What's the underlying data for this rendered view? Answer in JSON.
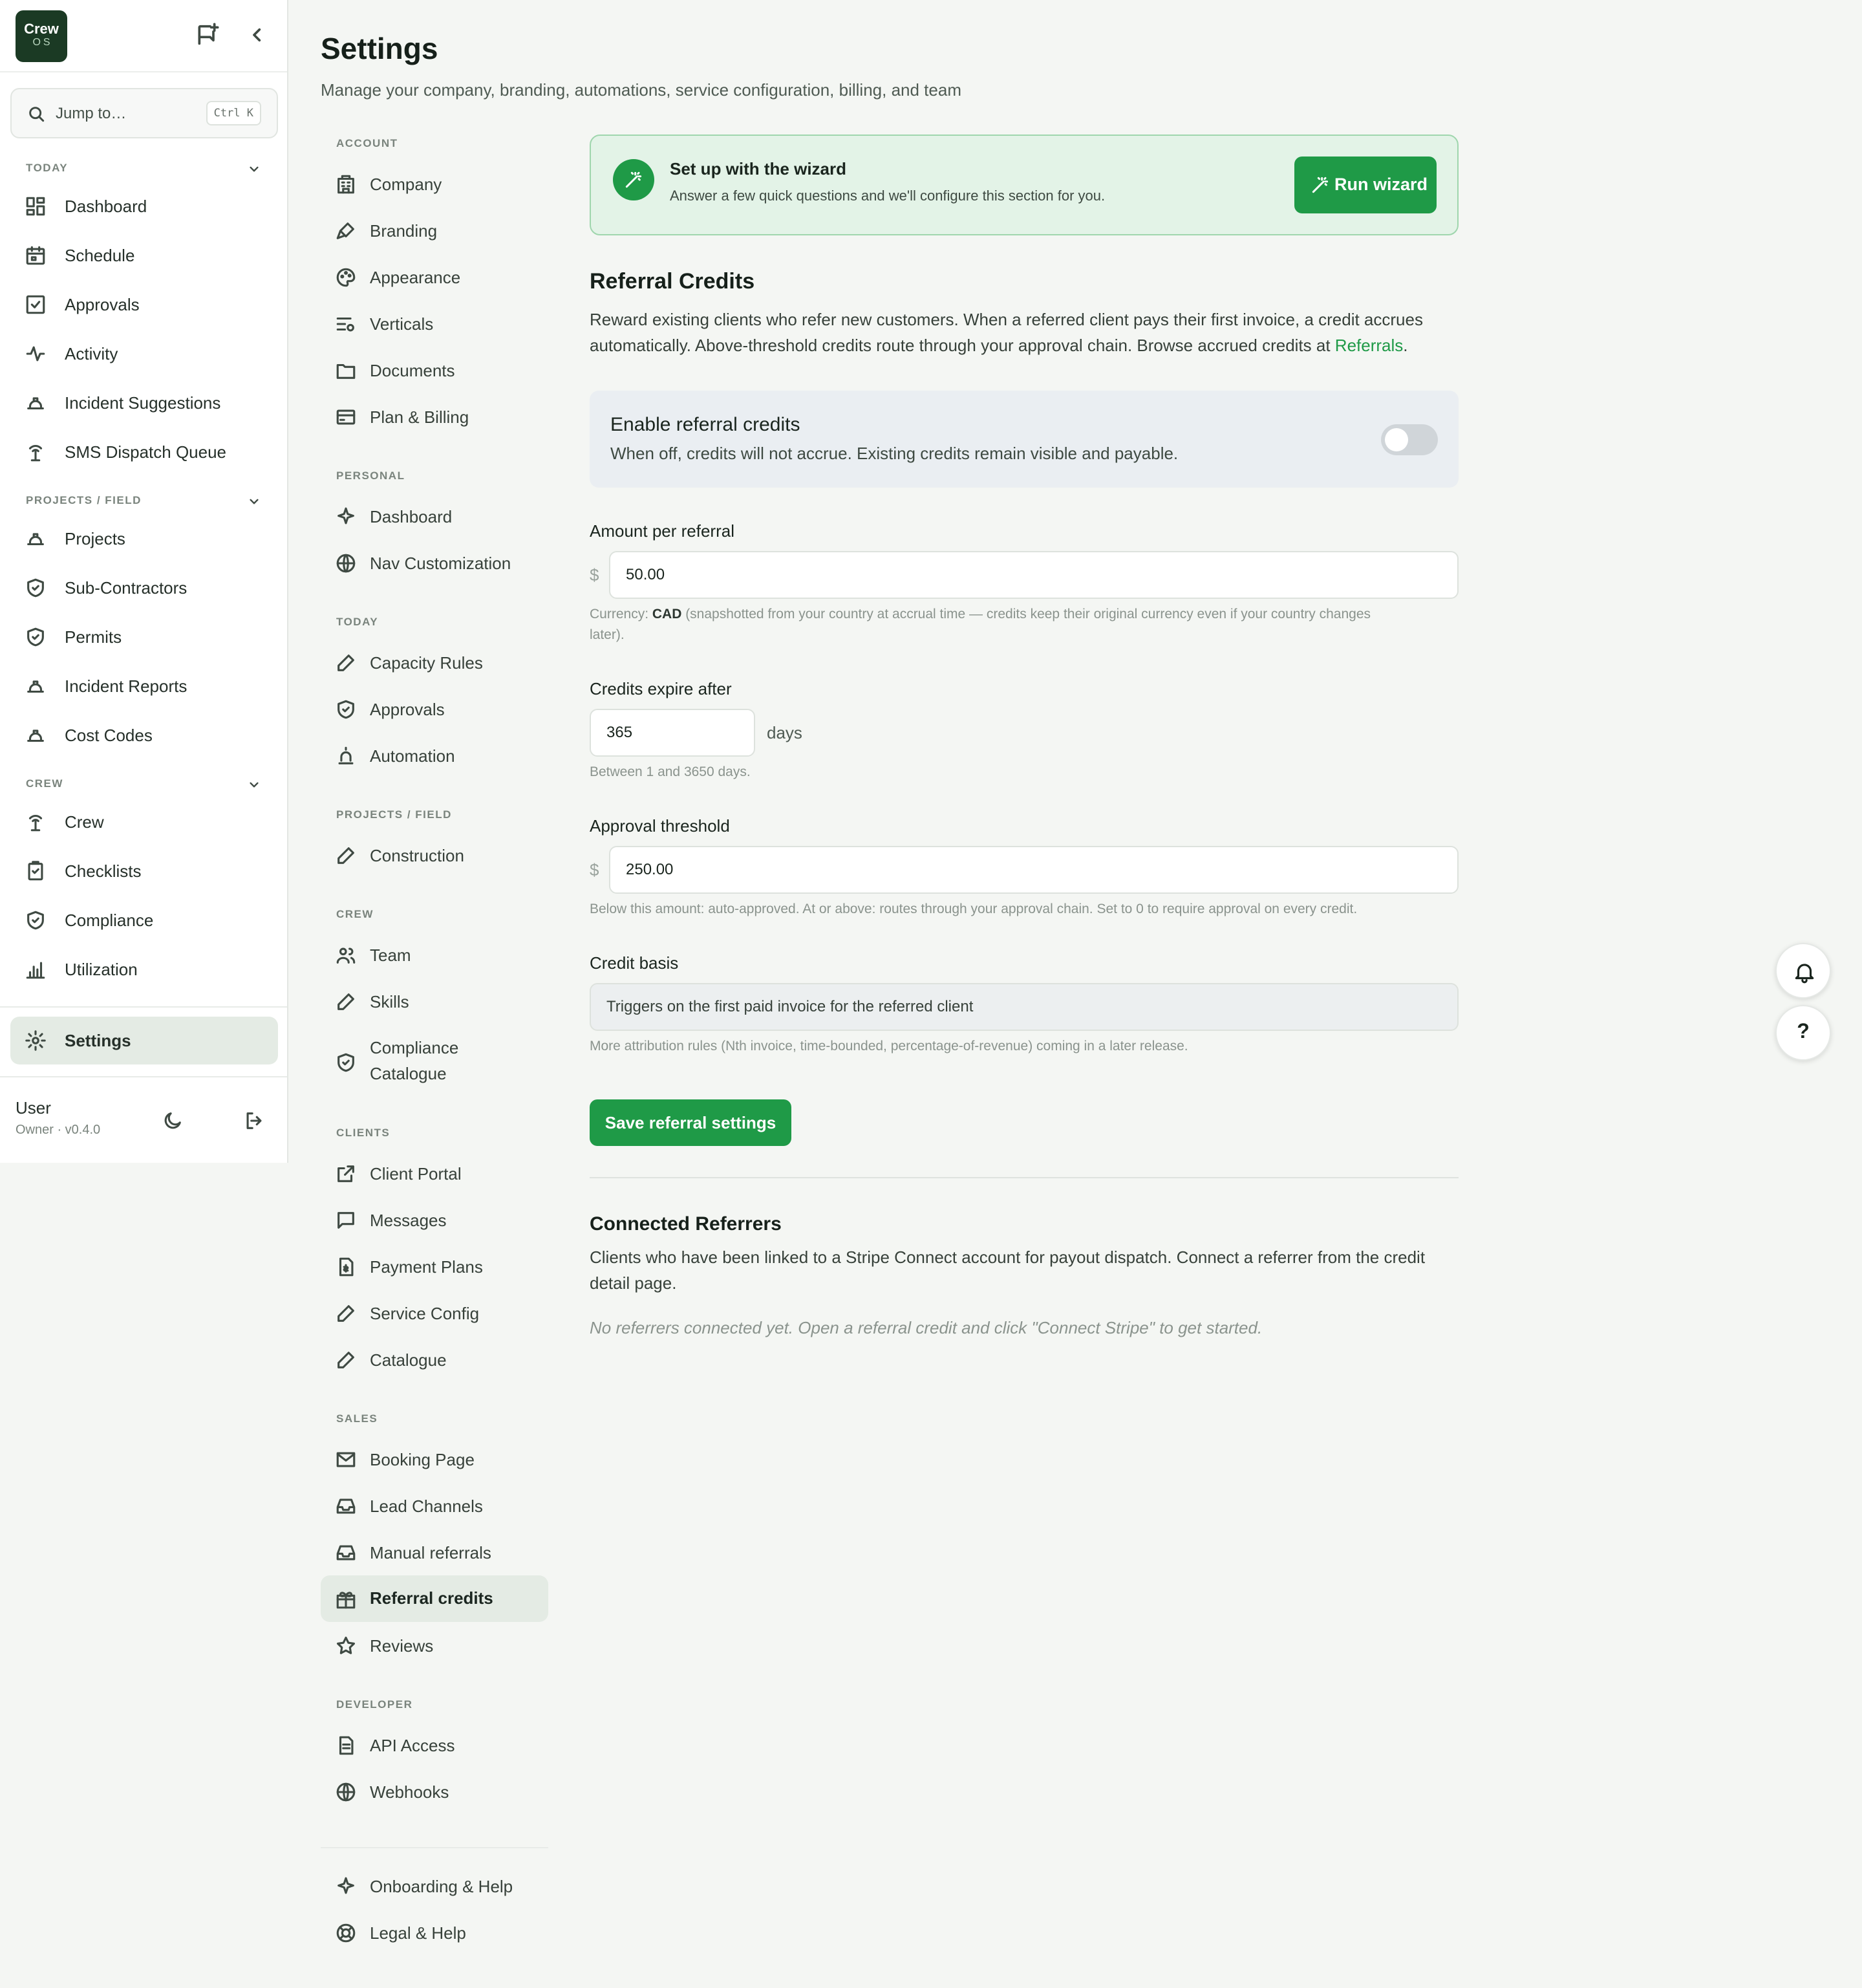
{
  "app": {
    "logo_line1": "Crew",
    "logo_line2": "OS"
  },
  "search": {
    "placeholder": "Jump to…",
    "shortcut": "Ctrl K"
  },
  "sidebar": {
    "sections": [
      {
        "label": "TODAY",
        "items": [
          "Dashboard",
          "Schedule",
          "Approvals",
          "Activity",
          "Incident Suggestions",
          "SMS Dispatch Queue"
        ]
      },
      {
        "label": "PROJECTS / FIELD",
        "items": [
          "Projects",
          "Sub-Contractors",
          "Permits",
          "Incident Reports",
          "Cost Codes"
        ]
      },
      {
        "label": "CREW",
        "items": [
          "Crew",
          "Checklists",
          "Compliance",
          "Utilization"
        ]
      }
    ],
    "settings_label": "Settings",
    "user_name": "User",
    "user_role": "Owner · v0.4.0"
  },
  "page": {
    "title": "Settings",
    "subtitle": "Manage your company, branding, automations, service configuration, billing, and team"
  },
  "settings_nav": {
    "account_label": "ACCOUNT",
    "account": [
      "Company",
      "Branding",
      "Appearance",
      "Verticals",
      "Documents",
      "Plan & Billing"
    ],
    "personal_label": "PERSONAL",
    "personal": [
      "Dashboard",
      "Nav Customization"
    ],
    "today_label": "TODAY",
    "today": [
      "Capacity Rules",
      "Approvals",
      "Automation"
    ],
    "projects_label": "PROJECTS / FIELD",
    "projects": [
      "Construction"
    ],
    "crew_label": "CREW",
    "crew": [
      "Team",
      "Skills",
      "Compliance Catalogue"
    ],
    "clients_label": "CLIENTS",
    "clients": [
      "Client Portal",
      "Messages",
      "Payment Plans",
      "Service Config",
      "Catalogue"
    ],
    "sales_label": "SALES",
    "sales": [
      "Booking Page",
      "Lead Channels",
      "Manual referrals",
      "Referral credits",
      "Reviews"
    ],
    "developer_label": "DEVELOPER",
    "developer": [
      "API Access",
      "Webhooks"
    ],
    "footer": [
      "Onboarding & Help",
      "Legal & Help"
    ]
  },
  "wizard": {
    "title": "Set up with the wizard",
    "subtitle": "Answer a few quick questions and we'll configure this section for you.",
    "button": "Run wizard"
  },
  "referral": {
    "heading": "Referral Credits",
    "description_1": "Reward existing clients who refer new customers. When a referred client pays their first invoice, a credit accrues",
    "description_2": "automatically. Above-threshold credits route through your approval chain. Browse accrued credits at ",
    "description_link": "Referrals",
    "description_end": ".",
    "toggle_title": "Enable referral credits",
    "toggle_desc": "When off, credits will not accrue. Existing credits remain visible and payable.",
    "toggle_on": false,
    "amount_label": "Amount per referral",
    "currency_symbol": "$",
    "amount_value": "50.00",
    "currency_prefix": "Currency: ",
    "currency_code": "CAD",
    "currency_note_1": " (snapshotted from your country at accrual time — credits keep their original currency even if your country changes",
    "currency_note_2": "later).",
    "expire_label": "Credits expire after",
    "expire_value": "365",
    "expire_unit": "days",
    "expire_help": "Between 1 and 3650 days.",
    "threshold_label": "Approval threshold",
    "threshold_value": "250.00",
    "threshold_help": "Below this amount: auto-approved. At or above: routes through your approval chain. Set to 0 to require approval on every credit.",
    "basis_label": "Credit basis",
    "basis_value": "Triggers on the first paid invoice for the referred client",
    "basis_help": "More attribution rules (Nth invoice, time-bounded, percentage-of-revenue) coming in a later release.",
    "save_button": "Save referral settings"
  },
  "connected": {
    "heading": "Connected Referrers",
    "description_1": "Clients who have been linked to a Stripe Connect account for payout dispatch. Connect a referrer from the credit",
    "description_2": "detail page.",
    "empty": "No referrers connected yet. Open a referral credit and click \"Connect Stripe\" to get started."
  },
  "floating": {
    "help": "?"
  },
  "colors": {
    "accent": "#1f9a47",
    "logo_bg": "#1b3a24",
    "active_bg": "#e4ebe4"
  }
}
